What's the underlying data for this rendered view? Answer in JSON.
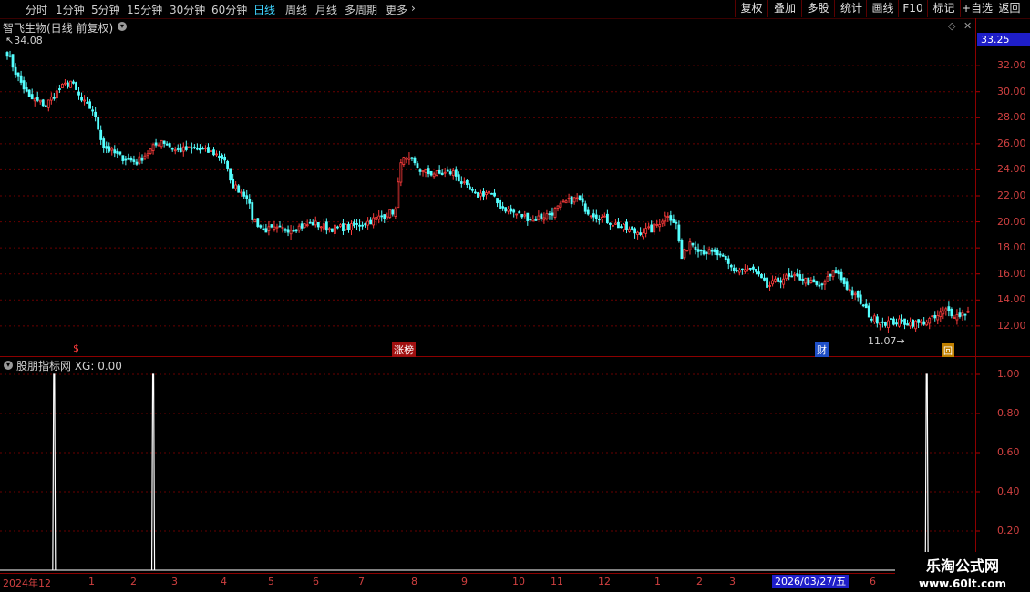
{
  "toolbar": {
    "timeframes": [
      {
        "label": "分时",
        "active": false
      },
      {
        "label": "1分钟",
        "active": false
      },
      {
        "label": "5分钟",
        "active": false
      },
      {
        "label": "15分钟",
        "active": false
      },
      {
        "label": "30分钟",
        "active": false
      },
      {
        "label": "60分钟",
        "active": false
      },
      {
        "label": "日线",
        "active": true
      },
      {
        "label": "周线",
        "active": false
      },
      {
        "label": "月线",
        "active": false
      },
      {
        "label": "多周期",
        "active": false
      },
      {
        "label": "更多",
        "active": false
      }
    ],
    "buttons": [
      "复权",
      "叠加",
      "多股",
      "统计",
      "画线",
      "F10",
      "标记",
      "+自选",
      "返回"
    ]
  },
  "stock": {
    "title": "智飞生物(日线 前复权)",
    "current_price": "33.25",
    "high_label": "34.08",
    "low_label": "11.07"
  },
  "price_axis": [
    "32.00",
    "30.00",
    "28.00",
    "26.00",
    "24.00",
    "22.00",
    "20.00",
    "18.00",
    "16.00",
    "14.00",
    "12.00"
  ],
  "markers": {
    "dollar": "$",
    "limit_list": "涨榜",
    "finance": "财",
    "buyback": "回"
  },
  "indicator": {
    "title": "股朋指标网 XG: 0.00",
    "axis": [
      "1.00",
      "0.80",
      "0.60",
      "0.40",
      "0.20"
    ]
  },
  "dates": {
    "year_label": "2024年12",
    "months": [
      "1",
      "2",
      "3",
      "4",
      "5",
      "6",
      "7",
      "8",
      "9",
      "10",
      "11",
      "12",
      "1",
      "2",
      "3",
      "6"
    ],
    "cursor_date": "2026/03/27/五"
  },
  "watermark": {
    "line1": "乐淘公式网",
    "line2": "www.60lt.com"
  },
  "colors": {
    "up": "#ff3c3c",
    "down": "#54ffff",
    "frame": "#8c0000",
    "accent": "#1e1ec8"
  },
  "chart_data": {
    "type": "candlestick",
    "ylim": [
      11,
      34.5
    ],
    "price_series_anchors": [
      [
        0,
        33.0
      ],
      [
        3,
        31.5
      ],
      [
        8,
        29.5
      ],
      [
        14,
        29.0
      ],
      [
        19,
        30.2
      ],
      [
        23,
        30.8
      ],
      [
        27,
        29.3
      ],
      [
        31,
        28.6
      ],
      [
        35,
        25.8
      ],
      [
        41,
        25.0
      ],
      [
        47,
        24.6
      ],
      [
        52,
        25.5
      ],
      [
        56,
        26.3
      ],
      [
        61,
        25.5
      ],
      [
        68,
        25.6
      ],
      [
        75,
        25.3
      ],
      [
        79,
        24.8
      ],
      [
        81,
        23.0
      ],
      [
        84,
        22.5
      ],
      [
        87,
        22.0
      ],
      [
        89,
        20.3
      ],
      [
        93,
        19.4
      ],
      [
        98,
        19.4
      ],
      [
        104,
        19.5
      ],
      [
        111,
        19.9
      ],
      [
        117,
        19.5
      ],
      [
        125,
        19.6
      ],
      [
        131,
        20.0
      ],
      [
        137,
        20.5
      ],
      [
        141,
        20.9
      ],
      [
        143,
        24.8
      ],
      [
        147,
        24.6
      ],
      [
        151,
        23.8
      ],
      [
        157,
        23.7
      ],
      [
        162,
        23.8
      ],
      [
        166,
        22.8
      ],
      [
        170,
        22.0
      ],
      [
        175,
        22.3
      ],
      [
        179,
        21.2
      ],
      [
        185,
        20.6
      ],
      [
        191,
        20.2
      ],
      [
        197,
        20.6
      ],
      [
        203,
        21.5
      ],
      [
        207,
        21.8
      ],
      [
        211,
        20.8
      ],
      [
        217,
        20.2
      ],
      [
        222,
        19.7
      ],
      [
        228,
        19.2
      ],
      [
        234,
        19.4
      ],
      [
        240,
        20.6
      ],
      [
        243,
        19.8
      ],
      [
        245,
        17.2
      ],
      [
        248,
        18.5
      ],
      [
        252,
        17.8
      ],
      [
        258,
        17.5
      ],
      [
        264,
        16.3
      ],
      [
        271,
        16.3
      ],
      [
        276,
        15.0
      ],
      [
        282,
        15.7
      ],
      [
        288,
        15.7
      ],
      [
        295,
        15.0
      ],
      [
        301,
        16.2
      ],
      [
        305,
        15.0
      ],
      [
        310,
        13.8
      ],
      [
        314,
        12.6
      ],
      [
        319,
        12.3
      ],
      [
        325,
        12.3
      ],
      [
        331,
        12.2
      ],
      [
        337,
        12.6
      ],
      [
        341,
        13.2
      ],
      [
        345,
        12.8
      ],
      [
        349,
        13.1
      ]
    ],
    "indicator_xg": [
      {
        "bar": 17,
        "value": 1.0
      },
      {
        "bar": 53,
        "value": 1.0
      },
      {
        "bar": 334,
        "value": 1.0
      }
    ]
  }
}
